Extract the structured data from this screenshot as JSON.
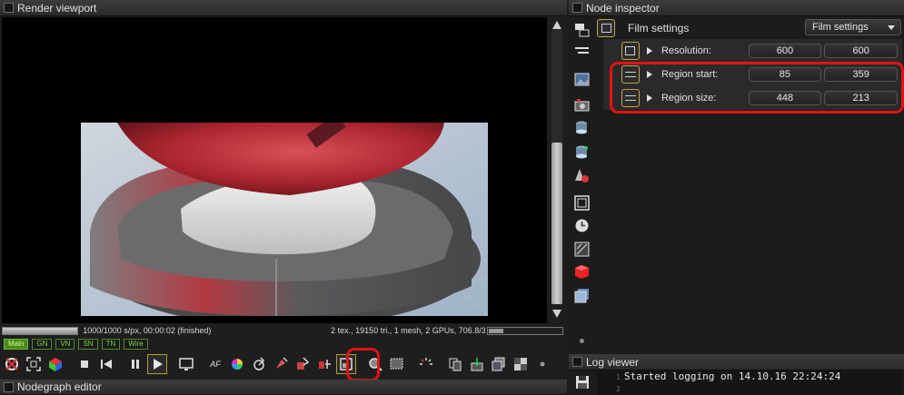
{
  "render_viewport": {
    "title": "Render viewport",
    "progress_fraction": 1.0,
    "samples_status": "1000/1000 s/px, 00:00:02 (finished)",
    "scene_stats": "2 tex., 19150 tri., 1 mesh, 2 GPUs, 706.8/3855/4...",
    "kernel_tabs": [
      {
        "label": "Main",
        "active": true
      },
      {
        "label": "GN",
        "active": false
      },
      {
        "label": "VN",
        "active": false
      },
      {
        "label": "SN",
        "active": false
      },
      {
        "label": "TN",
        "active": false
      },
      {
        "label": "Wire",
        "active": false
      }
    ],
    "toolbar_icons": [
      "recenter-icon",
      "fit-icon",
      "color-cube-icon",
      "stop-icon",
      "restart-icon",
      "pause-icon",
      "play-icon",
      "monitor-icon",
      "af-icon",
      "color-wheel-icon",
      "picker-icon",
      "material-picker-icon",
      "object-picker-icon",
      "camera-target-icon",
      "region-render-icon",
      "zoom-icon",
      "region-select-icon",
      "spinner-icon",
      "copy-icon",
      "export-icon",
      "stack-icon",
      "checker-icon"
    ],
    "toolbar_af_label": "AF"
  },
  "nodegraph": {
    "title": "Nodegraph editor"
  },
  "inspector": {
    "title": "Node inspector",
    "node_name": "Film settings",
    "dropdown_value": "Film settings",
    "params": [
      {
        "label": "Resolution:",
        "x": "600",
        "y": "600"
      },
      {
        "label": "Region start:",
        "x": "85",
        "y": "359"
      },
      {
        "label": "Region size:",
        "x": "448",
        "y": "213"
      }
    ],
    "side_icons": [
      "layers-icon",
      "list-icon",
      "image-icon",
      "camera-icon",
      "database-icon",
      "database-alt-icon",
      "shapes-icon",
      "film-icon",
      "clock-icon",
      "texture-icon",
      "red-cube-icon",
      "blue-cube-icon",
      "dot-icon"
    ]
  },
  "log_viewer": {
    "title": "Log viewer",
    "lines": [
      {
        "num": "1",
        "text": "Started logging on 14.10.16 22:24:24"
      },
      {
        "num": "2",
        "text": ""
      }
    ]
  },
  "colors": {
    "highlight": "#e31212",
    "active_green": "#4a8a1c"
  }
}
